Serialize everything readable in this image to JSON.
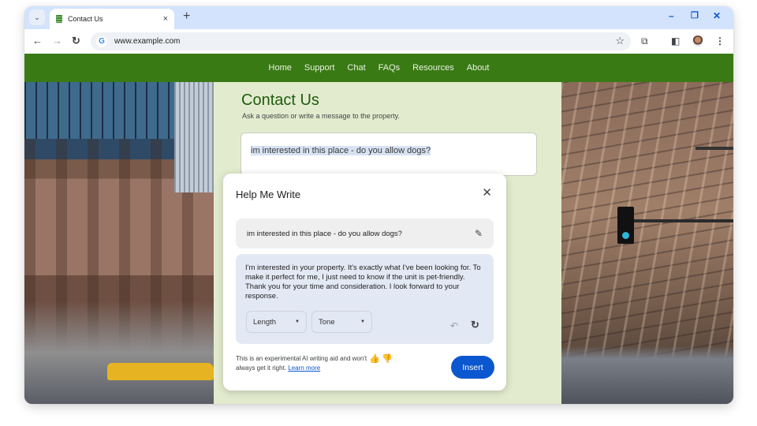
{
  "browser": {
    "tab": {
      "title": "Contact Us",
      "close_icon": "×"
    },
    "new_tab_icon": "+",
    "tab_search_icon": "⌄",
    "window_controls": {
      "minimize": "–",
      "restore": "❐",
      "close": "✕"
    },
    "nav": {
      "back": "←",
      "forward": "→",
      "reload": "↻"
    },
    "omnibox": {
      "g_icon": "G",
      "url": "www.example.com",
      "star_icon": "☆"
    },
    "toolbar_icons": {
      "extensions": "⧉",
      "side_panel": "◧",
      "menu": "⋮"
    }
  },
  "site": {
    "colors": {
      "brand_green": "#3a7a15",
      "heading_green": "#1e5c0c",
      "page_bg": "#e3ebcf",
      "primary_blue": "#0b57d0"
    },
    "navbar": [
      "Home",
      "Support",
      "Chat",
      "FAQs",
      "Resources",
      "About"
    ],
    "heading": "Contact Us",
    "subheading": "Ask a question or write a message to the property.",
    "message": "im interested in this place - do you allow dogs?"
  },
  "help_me_write": {
    "title": "Help Me Write",
    "close_icon": "✕",
    "prompt": "im interested in this place - do you allow dogs?",
    "edit_icon": "✎",
    "result": "I'm interested in your property. It's exactly what I've been looking for. To make it perfect for me, I just need to know if the unit is pet-friendly. Thank you for your time and consideration. I look forward to your response.",
    "length_label": "Length",
    "tone_label": "Tone",
    "caret": "▼",
    "undo_icon": "↶",
    "redo_icon": "↻",
    "disclaimer": "This is an experimental AI writing aid and won't always get it right.",
    "learn_more": "Learn more",
    "thumbs_up": "👍",
    "thumbs_down": "👎",
    "insert_label": "Insert"
  }
}
